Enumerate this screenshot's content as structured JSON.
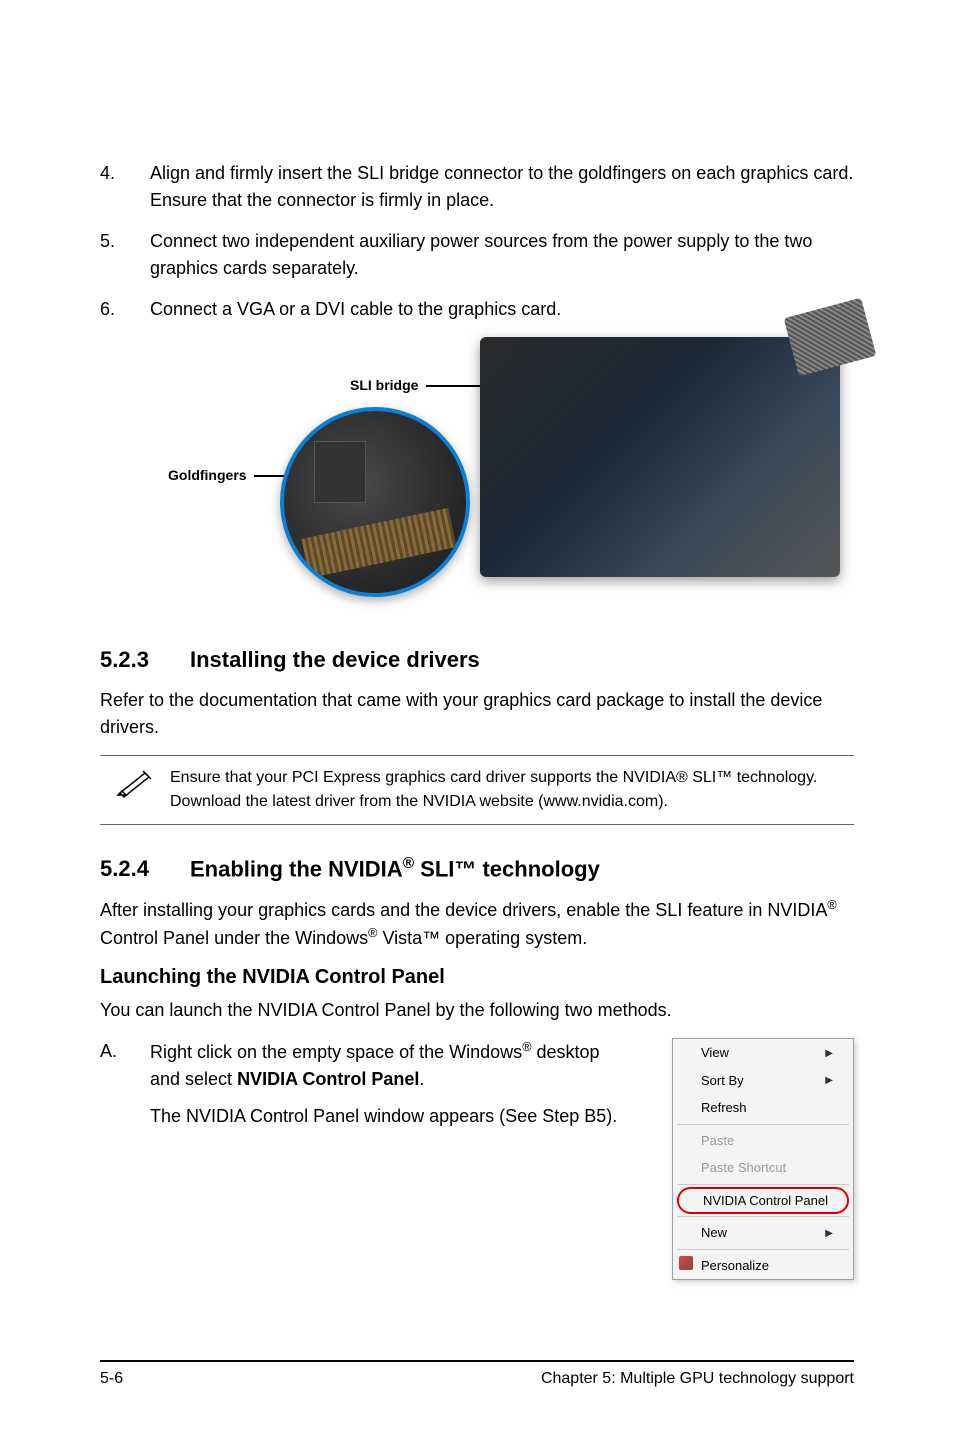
{
  "steps": {
    "item4": {
      "num": "4.",
      "text": "Align and firmly insert the SLI bridge connector to the goldfingers on each graphics card. Ensure that the connector is firmly in place."
    },
    "item5": {
      "num": "5.",
      "text": "Connect two independent auxiliary power sources from the power supply to the two graphics cards separately."
    },
    "item6": {
      "num": "6.",
      "text": "Connect a VGA or a DVI cable to the graphics card."
    }
  },
  "figure": {
    "label_sli": "SLI bridge",
    "label_gold": "Goldfingers"
  },
  "section523": {
    "num": "5.2.3",
    "title": "Installing the device drivers",
    "body": "Refer to the documentation that came with your graphics card package to install the device drivers."
  },
  "note": {
    "text": "Ensure that your PCI Express graphics card driver supports the NVIDIA® SLI™ technology. Download the latest driver from the NVIDIA website (www.nvidia.com)."
  },
  "section524": {
    "num": "5.2.4",
    "title_prefix": "Enabling the NVIDIA",
    "title_suffix": " SLI™ technology",
    "body_prefix": "After installing your graphics cards and the device drivers, enable the SLI feature in NVIDIA",
    "body_mid": " Control Panel under the Windows",
    "body_suffix": " Vista™ operating system."
  },
  "launch": {
    "heading": "Launching the NVIDIA Control Panel",
    "body": "You can launch the NVIDIA Control Panel by the following two methods."
  },
  "stepA": {
    "letter": "A.",
    "line1_prefix": "Right click on the empty space of the Windows",
    "line1_suffix": " desktop and select ",
    "line1_bold": "NVIDIA Control Panel",
    "line1_end": ".",
    "line2": "The NVIDIA Control Panel window appears (See Step B5)."
  },
  "menu": {
    "view": "View",
    "sortby": "Sort By",
    "refresh": "Refresh",
    "paste": "Paste",
    "paste_shortcut": "Paste Shortcut",
    "nvidia": "NVIDIA Control Panel",
    "new": "New",
    "personalize": "Personalize"
  },
  "footer": {
    "page": "5-6",
    "chapter": "Chapter 5: Multiple GPU technology support"
  }
}
